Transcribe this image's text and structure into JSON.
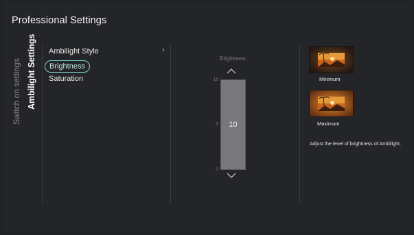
{
  "window": {
    "title": "Professional Settings"
  },
  "tabs": [
    {
      "label": "Switch on settings",
      "active": false
    },
    {
      "label": "Ambilight Settings",
      "active": true
    }
  ],
  "menu": {
    "items": [
      {
        "label": "Ambilight Style",
        "has_submenu": true
      },
      {
        "label": "Brightness",
        "selected": true
      },
      {
        "label": "Saturation"
      }
    ],
    "submenu_icon": "chevron-right-icon"
  },
  "slider": {
    "label": "Brightness",
    "value": 10,
    "min": 0,
    "max": 10,
    "mid": 5,
    "up_icon": "chevron-up-icon",
    "down_icon": "chevron-down-icon"
  },
  "preview": {
    "min_label": "Minimum",
    "max_label": "Maximum",
    "description": "Adjust the level of brightness of Ambilight."
  },
  "colors": {
    "background": "#242528",
    "selection_outline": "#7fd3cf",
    "slider_fill": "#77777c"
  }
}
